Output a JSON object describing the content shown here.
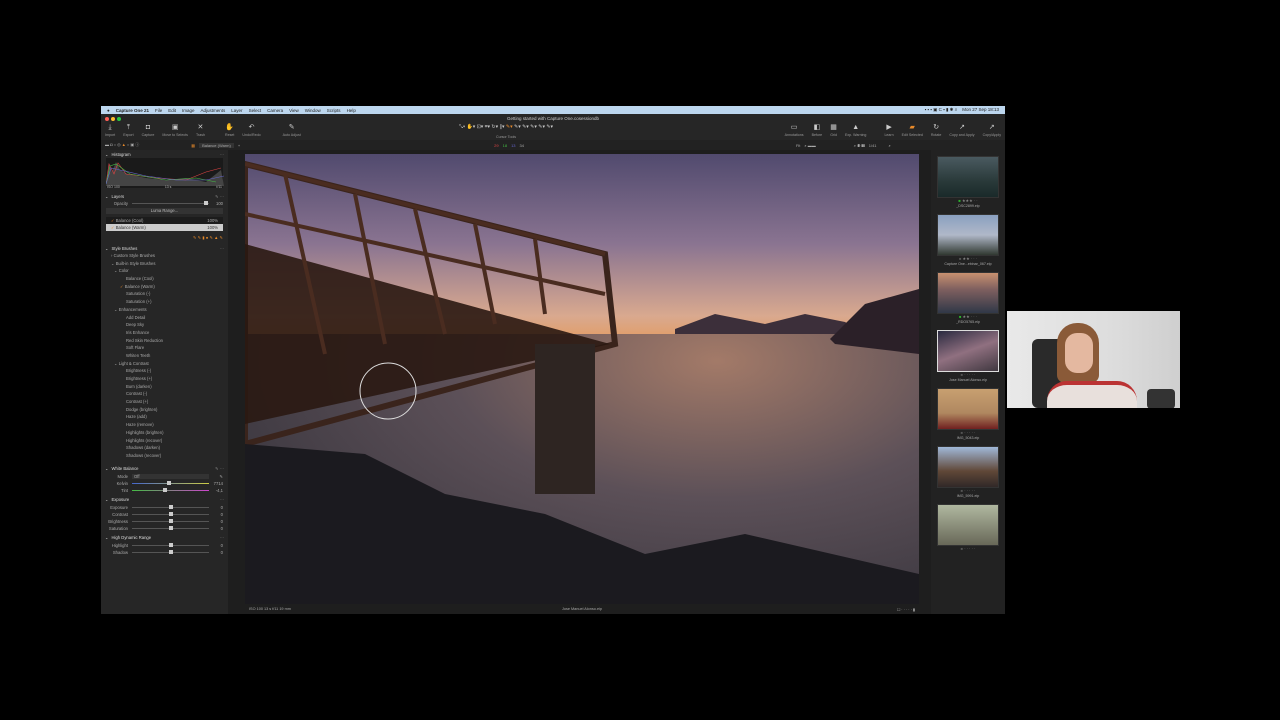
{
  "menubar": {
    "app": "Capture One 21",
    "items": [
      "File",
      "Edit",
      "Image",
      "Adjustments",
      "Layer",
      "Select",
      "Camera",
      "View",
      "Window",
      "Scripts",
      "Help"
    ],
    "clock": "Mon 27 Sep 18:13"
  },
  "window_title": "Getting started with Capture One.cosessiondb",
  "toolbar_left": [
    {
      "icon": "import-icon",
      "label": "Import"
    },
    {
      "icon": "export-icon",
      "label": "Export"
    },
    {
      "icon": "capture-icon",
      "label": "Capture"
    },
    {
      "icon": "move-to-selects-icon",
      "label": "Move to Selects"
    },
    {
      "icon": "trash-icon",
      "label": "Trash"
    },
    {
      "icon": "reset-icon",
      "label": "Reset"
    },
    {
      "icon": "undo-redo-icon",
      "label": "Undo/Redo"
    },
    {
      "icon": "auto-adjust-icon",
      "label": "Auto Adjust"
    }
  ],
  "cursor_tools_label": "Cursor Tools",
  "toolbar_right": [
    {
      "icon": "annotations-icon",
      "label": "Annotations"
    },
    {
      "icon": "before-icon",
      "label": "Before"
    },
    {
      "icon": "grid-icon",
      "label": "Grid"
    },
    {
      "icon": "exp-warning-icon",
      "label": "Exp. Warning"
    },
    {
      "icon": "learn-icon",
      "label": "Learn"
    },
    {
      "icon": "edit-selected-icon",
      "label": "Edit Selected"
    },
    {
      "icon": "rotate-icon",
      "label": "Rotate"
    },
    {
      "icon": "copy-apply-icon",
      "label": "Copy and Apply"
    },
    {
      "icon": "copy-apply2-icon",
      "label": "Copy/Apply"
    }
  ],
  "subbar": {
    "layer_select": "Balance (Warm)",
    "counts": [
      "29",
      "18",
      "13",
      "34"
    ],
    "fit": "Fit",
    "page": "1/41"
  },
  "histogram": {
    "title": "Histogram",
    "iso": "ISO 100",
    "shutter": "13 s",
    "aperture": "f/11"
  },
  "layers": {
    "title": "Layers",
    "opacity_label": "Opacity",
    "opacity_value": "100",
    "luma_button": "Luma Range...",
    "items": [
      {
        "name": "Balance (Cool)",
        "value": "100%"
      },
      {
        "name": "Balance (Warm)",
        "value": "100%"
      }
    ]
  },
  "style_brushes": {
    "title": "Style Brushes",
    "custom": "Custom Style Brushes",
    "builtin": "Built-in Style Brushes",
    "groups": [
      {
        "name": "Color",
        "items": [
          "Balance (Cool)",
          "Balance (Warm)",
          "Saturation (-)",
          "Saturation (+)"
        ]
      },
      {
        "name": "Enhancements",
        "items": [
          "Add Detail",
          "Deep Sky",
          "Iris Enhance",
          "Red Skin Reduction",
          "Soft Flare",
          "Whiten Teeth"
        ]
      },
      {
        "name": "Light & Contrast",
        "items": [
          "Brightness (-)",
          "Brightness (+)",
          "Burn (darken)",
          "Contrast (-)",
          "Contrast (+)",
          "Dodge (brighten)",
          "Haze (add)",
          "Haze (remove)",
          "Highlights (brighten)",
          "Highlights (recover)",
          "Shadows (darken)",
          "Shadows (recover)"
        ]
      }
    ]
  },
  "white_balance": {
    "title": "White Balance",
    "mode_label": "Mode",
    "mode_value": "Off",
    "kelvin_label": "Kelvin",
    "kelvin_value": "7714",
    "tint_label": "Tint",
    "tint_value": "-4,1"
  },
  "exposure": {
    "title": "Exposure",
    "rows": [
      {
        "label": "Exposure",
        "value": "0"
      },
      {
        "label": "Contrast",
        "value": "0"
      },
      {
        "label": "Brightness",
        "value": "0"
      },
      {
        "label": "Saturation",
        "value": "0"
      }
    ]
  },
  "hdr": {
    "title": "High Dynamic Range",
    "rows": [
      {
        "label": "Highlight",
        "value": "0"
      },
      {
        "label": "Shadow",
        "value": "0"
      }
    ]
  },
  "viewer_footer": {
    "meta": "ISO 100   13 s   f/11   19 mm",
    "filename": "Jose Manuel Alonso.eip"
  },
  "browser": [
    {
      "name": "_DSC2899.eip",
      "rating": 3,
      "tag": "#2bb52b"
    },
    {
      "name": "Capture One...ebinar_067.eip",
      "rating": 2
    },
    {
      "name": "_RDO5765.eip",
      "rating": 2,
      "tag": "#2bb52b"
    },
    {
      "name": "Jose Manuel Alonso.eip",
      "rating": 0,
      "selected": true
    },
    {
      "name": "IMG_5043.eip",
      "rating": 0
    },
    {
      "name": "IMG_5991.eip",
      "rating": 0
    },
    {
      "name": "",
      "rating": 0
    }
  ]
}
